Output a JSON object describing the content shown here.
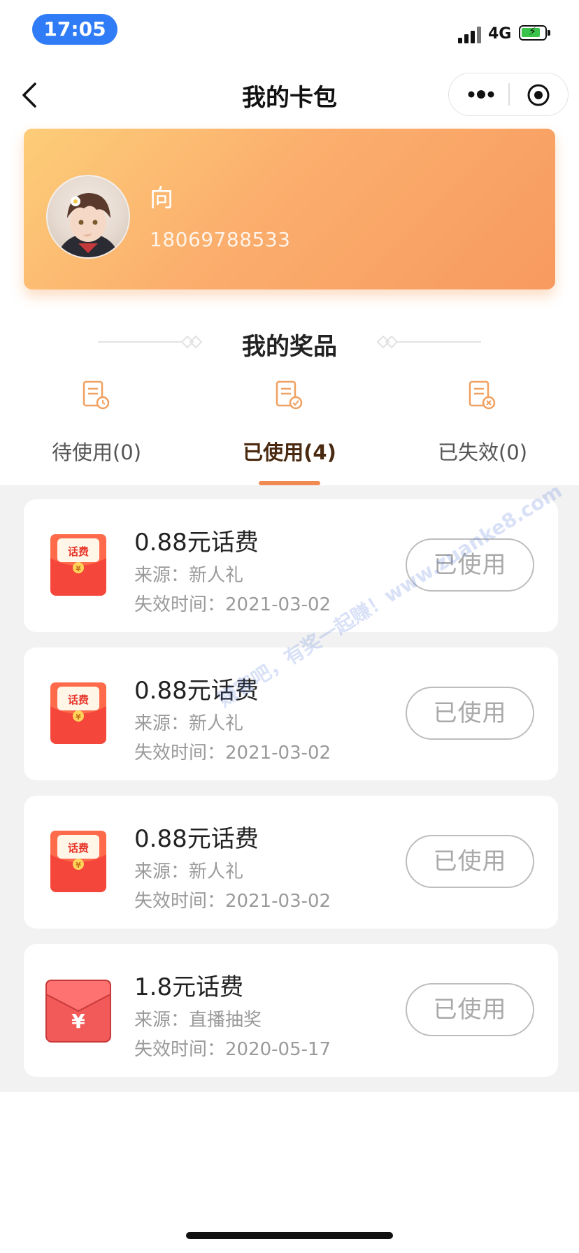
{
  "status_bar": {
    "time": "17:05",
    "network": "4G",
    "battery_level": 0.7,
    "battery_charging": true
  },
  "nav": {
    "title": "我的卡包",
    "back_icon": "chevron-left-icon",
    "more_icon": "more-dots-icon",
    "close_icon": "target-circle-icon"
  },
  "profile": {
    "name": "向",
    "phone": "18069788533"
  },
  "prizes_section": {
    "title": "我的奖品",
    "tabs": [
      {
        "label": "待使用(0)",
        "icon": "pending-document-clock-icon",
        "active": false
      },
      {
        "label": "已使用(4)",
        "icon": "used-document-check-icon",
        "active": true
      },
      {
        "label": "已失效(0)",
        "icon": "expired-document-x-icon",
        "active": false
      }
    ]
  },
  "prizes": [
    {
      "name": "0.88元话费",
      "source": "来源：新人礼",
      "expiry": "失效时间：2021-03-02",
      "status": "已使用",
      "icon": "phone-bill-red-envelope-icon",
      "icon_text": "话费"
    },
    {
      "name": "0.88元话费",
      "source": "来源：新人礼",
      "expiry": "失效时间：2021-03-02",
      "status": "已使用",
      "icon": "phone-bill-red-envelope-icon",
      "icon_text": "话费"
    },
    {
      "name": "0.88元话费",
      "source": "来源：新人礼",
      "expiry": "失效时间：2021-03-02",
      "status": "已使用",
      "icon": "phone-bill-red-envelope-icon",
      "icon_text": "话费"
    },
    {
      "name": "1.8元话费",
      "source": "来源：直播抽奖",
      "expiry": "失效时间：2020-05-17",
      "status": "已使用",
      "icon": "yuan-red-envelope-icon",
      "icon_text": "¥"
    }
  ],
  "watermark": "赚客吧，有奖一起赚！www.zuanke8.com",
  "colors": {
    "accent": "#f08a50",
    "card_gradient_start": "#fdcd78",
    "card_gradient_end": "#f79a5f",
    "time_pill": "#2f7cf6"
  }
}
